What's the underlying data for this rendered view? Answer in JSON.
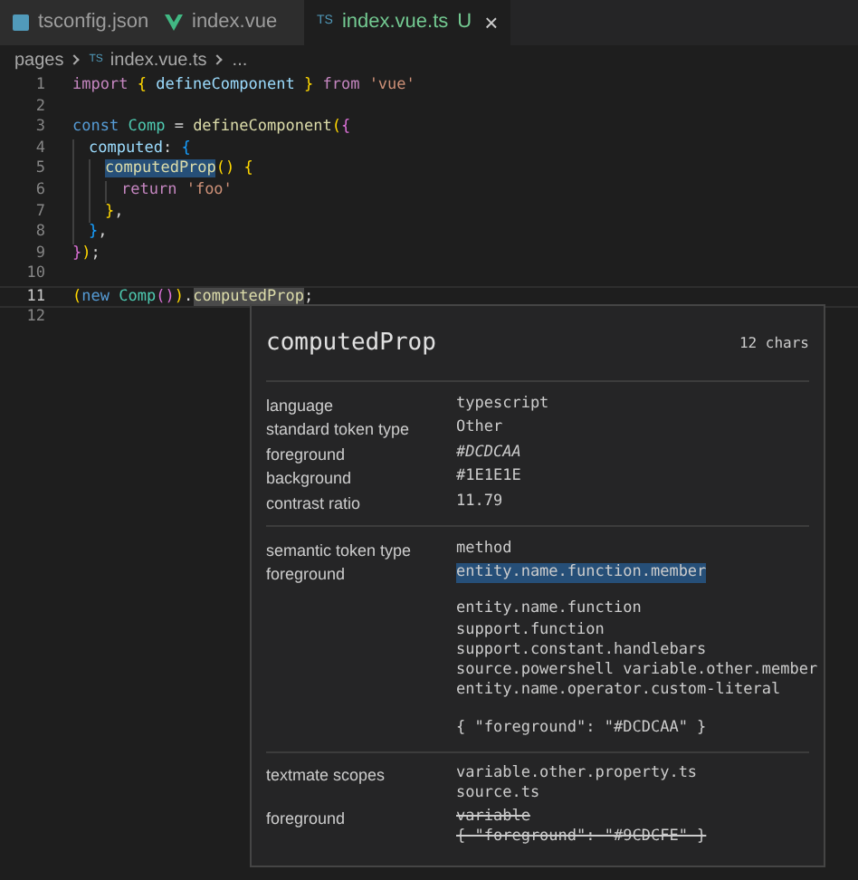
{
  "tabs": [
    {
      "label": "tsconfig.json",
      "kind": "json",
      "selected": false
    },
    {
      "label": "index.vue",
      "kind": "vue",
      "selected": false
    },
    {
      "label": "index.vue.ts",
      "kind": "ts",
      "icon_text": "TS",
      "selected": true,
      "status": "U",
      "close": "×"
    }
  ],
  "breadcrumb": [
    {
      "text": "pages"
    },
    {
      "text": "index.vue.ts",
      "icon_text": "TS"
    },
    {
      "text": "..."
    }
  ],
  "code_lines": [
    {
      "number": "1",
      "current": false,
      "tokens": [
        {
          "text": "import ",
          "kind": "control"
        },
        {
          "text": "{ ",
          "kind": "brace1"
        },
        {
          "text": "defineComponent ",
          "kind": "var"
        },
        {
          "text": "} ",
          "kind": "brace1"
        },
        {
          "text": "from ",
          "kind": "control"
        },
        {
          "text": "'vue'",
          "kind": "string"
        }
      ]
    },
    {
      "number": "2",
      "current": false
    },
    {
      "number": "3",
      "current": false,
      "tokens": [
        {
          "text": "const ",
          "kind": "keyword"
        },
        {
          "text": "Comp",
          "kind": "class"
        },
        {
          "text": " = "
        },
        {
          "text": "defineComponent",
          "kind": "func"
        },
        {
          "text": "(",
          "kind": "brace1"
        },
        {
          "text": "{",
          "kind": "brace2"
        }
      ],
      "children": [
        {
          "number": "4",
          "current": false,
          "tokens": [
            {
              "text": "computed",
              "kind": "var"
            },
            {
              "text": ": "
            },
            {
              "text": "{",
              "kind": "brace3"
            }
          ],
          "children": [
            {
              "number": "5",
              "current": false,
              "tokens": [
                {
                  "text": "computedProp",
                  "kind": "func",
                  "selected": true
                },
                {
                  "text": "() ",
                  "kind": "brace1"
                },
                {
                  "text": "{",
                  "kind": "brace1"
                }
              ],
              "children": [
                {
                  "number": "6",
                  "current": false,
                  "tokens": [
                    {
                      "text": "return ",
                      "kind": "control"
                    },
                    {
                      "text": "'foo'",
                      "kind": "string"
                    }
                  ]
                }
              ]
            },
            {
              "number": "7",
              "current": false,
              "tokens": [
                {
                  "text": "}",
                  "kind": "brace1"
                },
                {
                  "text": ","
                }
              ]
            }
          ]
        },
        {
          "number": "8",
          "current": false,
          "tokens": [
            {
              "text": "}",
              "kind": "brace3"
            },
            {
              "text": ","
            }
          ]
        }
      ]
    },
    {
      "number": "9",
      "current": false,
      "tokens": [
        {
          "text": "}",
          "kind": "brace2"
        },
        {
          "text": ")",
          "kind": "brace1"
        },
        {
          "text": ";"
        }
      ]
    },
    {
      "number": "10",
      "current": false
    },
    {
      "number": "11",
      "current": true,
      "tokens": [
        {
          "text": "(",
          "kind": "brace1"
        },
        {
          "text": "new ",
          "kind": "keyword"
        },
        {
          "text": "Comp",
          "kind": "class"
        },
        {
          "text": "()",
          "kind": "brace2"
        },
        {
          "text": ")",
          "kind": "brace1"
        },
        {
          "text": "."
        },
        {
          "text": "computedProp",
          "kind": "func",
          "highlighted": true
        },
        {
          "text": ";"
        }
      ]
    },
    {
      "number": "12",
      "current": false
    }
  ],
  "hover": {
    "title": "computedProp",
    "char_count": "12 chars",
    "sections": [
      {
        "rows": [
          {
            "label": "language",
            "groups": [
              [
                {
                  "text": "typescript"
                }
              ]
            ]
          },
          {
            "label": "standard token type",
            "groups": [
              [
                {
                  "text": "Other"
                }
              ]
            ]
          },
          {
            "label": "foreground",
            "groups": [
              [
                {
                  "text": "#DCDCAA",
                  "emphasized": true
                }
              ]
            ]
          },
          {
            "label": "background",
            "groups": [
              [
                {
                  "text": "#1E1E1E"
                }
              ]
            ]
          },
          {
            "label": "contrast ratio",
            "groups": [
              [
                {
                  "text": "11.79"
                }
              ]
            ]
          }
        ]
      },
      {
        "rows": [
          {
            "label": "semantic token type",
            "groups": [
              [
                {
                  "text": "method"
                }
              ]
            ]
          },
          {
            "label": "foreground",
            "groups": [
              [
                {
                  "text": "entity.name.function.member",
                  "selected": true
                }
              ],
              [
                {
                  "text": "entity.name.function"
                },
                {
                  "text": "support.function"
                },
                {
                  "text": "support.constant.handlebars"
                },
                {
                  "text": "source.powershell variable.other.member"
                },
                {
                  "text": "entity.name.operator.custom-literal"
                }
              ],
              [
                {
                  "text": "{ \"foreground\": \"#DCDCAA\" }"
                }
              ]
            ]
          }
        ]
      },
      {
        "rows": [
          {
            "label": "textmate scopes",
            "groups": [
              [
                {
                  "text": "variable.other.property.ts"
                },
                {
                  "text": "source.ts"
                }
              ]
            ]
          },
          {
            "label": "foreground",
            "groups": [
              [
                {
                  "text": "variable",
                  "overridden": true
                },
                {
                  "text": "{ \"foreground\": \"#9CDCFE\" }",
                  "overridden": true
                }
              ]
            ]
          }
        ]
      }
    ]
  }
}
